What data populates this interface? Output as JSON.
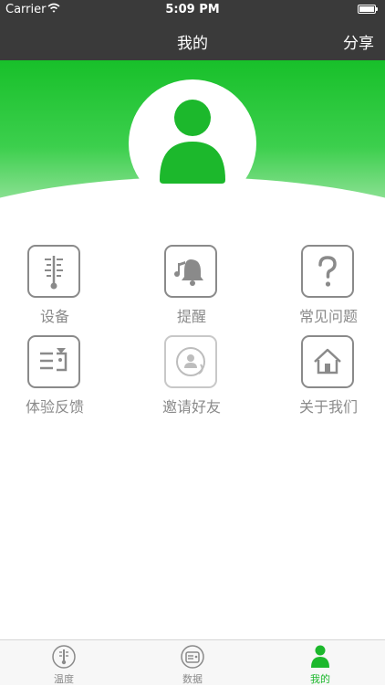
{
  "status_bar": {
    "carrier": "Carrier",
    "time": "5:09 PM"
  },
  "navbar": {
    "title": "我的",
    "share_label": "分享"
  },
  "colors": {
    "accent": "#1cb82c",
    "header_bg": "#3a3a3a",
    "icon_gray": "#8a8a8a"
  },
  "menu": {
    "items": [
      {
        "label": "设备",
        "icon": "thermometer-icon"
      },
      {
        "label": "提醒",
        "icon": "music-bell-icon"
      },
      {
        "label": "常见问题",
        "icon": "question-icon"
      },
      {
        "label": "体验反馈",
        "icon": "feedback-icon"
      },
      {
        "label": "邀请好友",
        "icon": "invite-icon"
      },
      {
        "label": "关于我们",
        "icon": "house-icon"
      }
    ]
  },
  "tabbar": {
    "tabs": [
      {
        "label": "温度",
        "icon": "thermometer-tab-icon",
        "active": false
      },
      {
        "label": "数据",
        "icon": "data-tab-icon",
        "active": false
      },
      {
        "label": "我的",
        "icon": "person-tab-icon",
        "active": true
      }
    ]
  }
}
